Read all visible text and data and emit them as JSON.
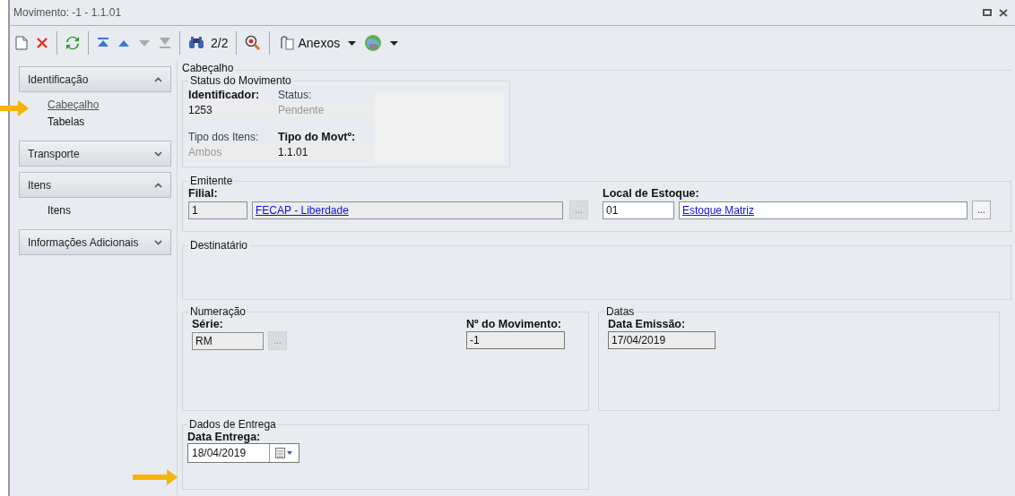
{
  "window": {
    "title": "Movimento: -1 - 1.1.01"
  },
  "toolbar": {
    "next_disabled": true,
    "last_disabled": true,
    "record_position": "2/2",
    "attachments_label": "Anexos"
  },
  "sidebar": {
    "groups": [
      {
        "label": "Identificação",
        "expanded": true,
        "items": [
          {
            "label": "Cabeçalho",
            "selected": true
          },
          {
            "label": "Tabelas",
            "selected": false
          }
        ]
      },
      {
        "label": "Transporte",
        "expanded": false
      },
      {
        "label": "Itens",
        "expanded": true,
        "items": [
          {
            "label": "Itens",
            "selected": false
          }
        ]
      },
      {
        "label": "Informações Adicionais",
        "expanded": false
      }
    ]
  },
  "header": {
    "title": "Cabeçalho",
    "status": {
      "title": "Status do Movimento",
      "fields": [
        {
          "label": "Identificador:",
          "required": true,
          "value": "1253",
          "disabled": false
        },
        {
          "label": "Status:",
          "required": false,
          "value": "Pendente",
          "disabled": true
        },
        {
          "label": "Tipo dos Itens:",
          "required": false,
          "value": "Ambos",
          "disabled": true
        },
        {
          "label": "Tipo do Movtº:",
          "required": true,
          "value": "1.1.01",
          "disabled": false
        }
      ]
    },
    "emitente": {
      "title": "Emitente",
      "fields": [
        {
          "label": "Filial:",
          "code": "1",
          "name": "FECAP - Liberdade",
          "disabled": true,
          "button": "..."
        },
        {
          "label": "Local de Estoque:",
          "code": "01",
          "name": "Estoque Matriz",
          "disabled": false,
          "button": "..."
        }
      ]
    },
    "destinatario": {
      "title": "Destinatário"
    },
    "numeracao": {
      "title": "Numeração",
      "serie_label": "Série:",
      "serie": "RM",
      "serie_button": "...",
      "numero_label": "Nº do Movimento:",
      "numero": "-1"
    },
    "datas": {
      "title": "Datas",
      "label": "Data Emissão:",
      "value": "17/04/2019"
    },
    "entrega": {
      "title": "Dados de Entrega",
      "label": "Data Entrega:",
      "value": "18/04/2019"
    }
  }
}
